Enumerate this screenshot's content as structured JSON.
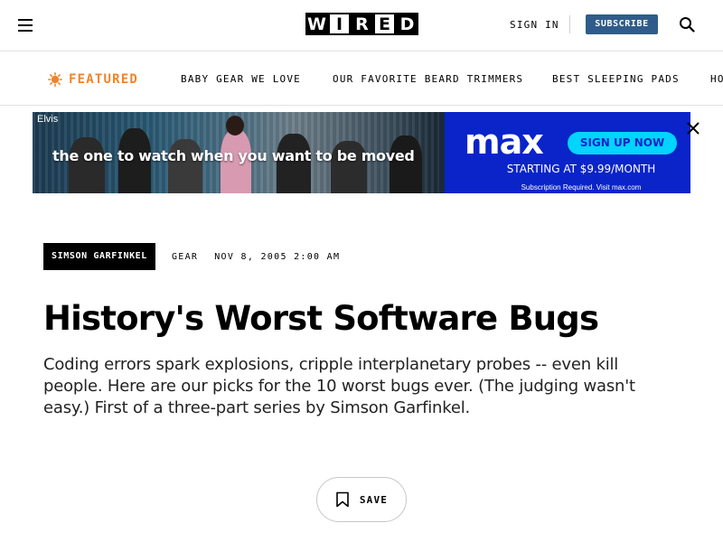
{
  "header": {
    "logo": [
      "W",
      "I",
      "R",
      "E",
      "D"
    ],
    "sign_in": "SIGN IN",
    "subscribe": "SUBSCRIBE"
  },
  "nav": {
    "featured_label": "FEATURED",
    "items": [
      {
        "label": "BABY GEAR WE LOVE"
      },
      {
        "label": "OUR FAVORITE BEARD TRIMMERS"
      },
      {
        "label": "BEST SLEEPING PADS"
      },
      {
        "label": "HO"
      }
    ]
  },
  "ad": {
    "corner_label": "Elvis",
    "tagline": "the one to watch when you want to be moved",
    "brand": "max",
    "cta": "SIGN UP NOW",
    "price": "STARTING AT $9.99/MONTH",
    "fine_print": "Subscription Required. Visit max.com"
  },
  "article": {
    "author": "SIMSON GARFINKEL",
    "category": "GEAR",
    "date": "NOV 8, 2005 2:00 AM",
    "title": "History's Worst Software Bugs",
    "dek": "Coding errors spark explosions, cripple interplanetary probes -- even kill people. Here are our picks for the 10 worst bugs ever. (The judging wasn't easy.) First of a three-part series by Simson Garfinkel.",
    "save_label": "SAVE"
  },
  "icons": {
    "menu": "hamburger-menu-icon",
    "search": "search-icon",
    "featured": "sun-burst-icon",
    "close": "close-icon",
    "bookmark": "bookmark-icon"
  },
  "colors": {
    "featured_accent": "#f0842c",
    "subscribe_bg": "#2f5c8a",
    "ad_brand_blue": "#0a24c9",
    "ad_cta_cyan": "#00d4ff"
  }
}
